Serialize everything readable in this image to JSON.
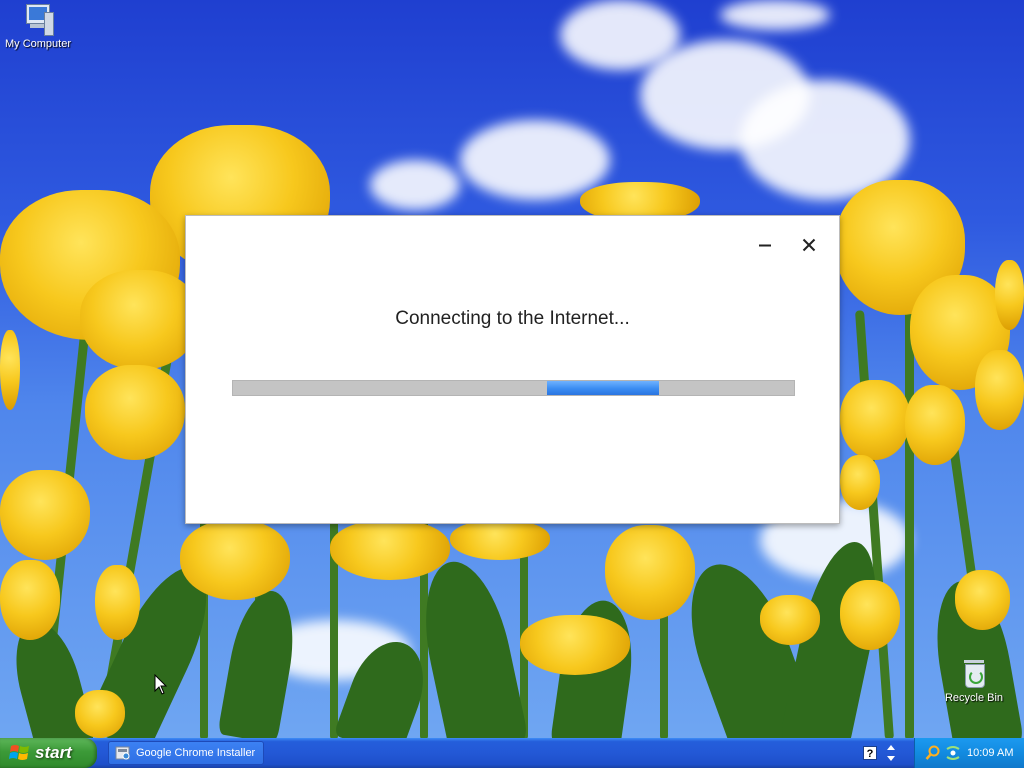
{
  "desktop": {
    "icons": [
      {
        "label": "My Computer"
      },
      {
        "label": "Recycle Bin"
      }
    ]
  },
  "installer": {
    "status_text": "Connecting to the Internet...",
    "progress": {
      "indeterminate": true,
      "chunk_start_fraction": 0.56,
      "chunk_width_fraction": 0.2
    }
  },
  "taskbar": {
    "start_label": "start",
    "tasks": [
      {
        "label": "Google Chrome Installer",
        "icon": "chrome-installer-icon"
      }
    ],
    "clock": "10:09 AM",
    "colors": {
      "bar": "#245edb",
      "start": "#3c9a38",
      "tray": "#128be0"
    }
  }
}
